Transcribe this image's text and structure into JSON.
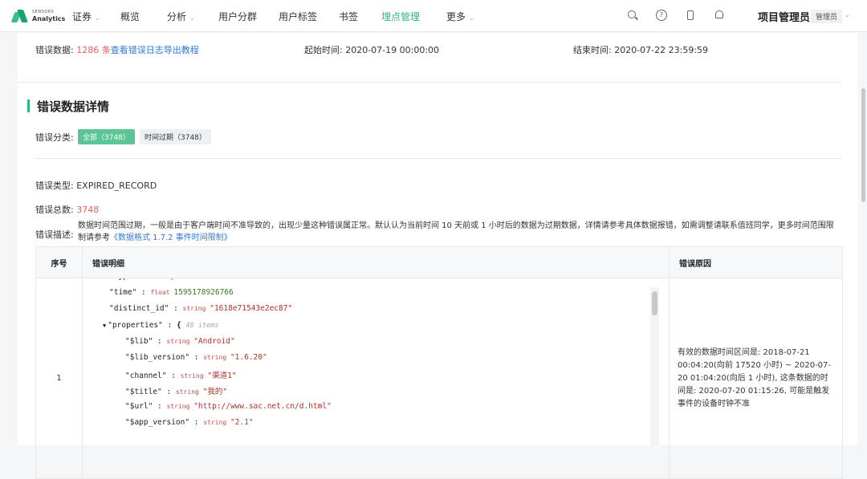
{
  "topbar": {
    "logo_line1": "SENSORS",
    "logo_line2": "Analytics",
    "nav": [
      {
        "label": "证券",
        "caret": "⌄"
      },
      {
        "label": "概览"
      },
      {
        "label": "分析",
        "caret": "⌄"
      },
      {
        "label": "用户分群"
      },
      {
        "label": "用户标签"
      },
      {
        "label": "书签"
      },
      {
        "label": "埋点管理",
        "active": true
      },
      {
        "label": "更多",
        "caret": "⌄"
      }
    ],
    "icons": [
      "search-icon",
      "help-icon",
      "mobile-icon",
      "bell-icon"
    ],
    "help_glyph": "?",
    "project": "项目管理员",
    "role": "管理员",
    "accent": "#32b583"
  },
  "summary": {
    "error_data_label": "错误数据:",
    "error_count": "1286 条",
    "export_link": "查看错误日志导出教程",
    "start_label": "起始时间:",
    "start_value": "2020-07-19 00:00:00",
    "end_label": "结束时间:",
    "end_value": "2020-07-22 23:59:59"
  },
  "detail": {
    "title": "错误数据详情",
    "category_label": "错误分类:",
    "tags": [
      "全部（3748）",
      "时间过期（3748）"
    ],
    "type_label": "错误类型:",
    "type_value": "EXPIRED_RECORD",
    "total_label": "错误总数:",
    "total_value": "3748",
    "desc_label": "错误描述:",
    "desc_text": "数据时间范围过期，一般是由于客户端时间不准导致的，出现少量这种错误属正常。默认认为当前时间 10 天前或 1 小时后的数据为过期数据，详情请参考具体数据报错，如需调整请联系值班同学，更多时间范围限制请参考",
    "desc_link": "《数据格式 1.7.2 事件时间限制》"
  },
  "table": {
    "headers": [
      "序号",
      "错误明细",
      "错误原因"
    ],
    "row": {
      "index": "1",
      "code_lines": [
        {
          "key": "\"type\"",
          "type": "string",
          "value": "\"track\"",
          "vclass": "st",
          "indent": 0
        },
        {
          "key": "\"time\"",
          "type": "float",
          "value": "1595178926766",
          "vclass": "nm",
          "indent": 0
        },
        {
          "key": "\"distinct_id\"",
          "type": "string",
          "value": "\"1618e71543e2ec87\"",
          "vclass": "st",
          "indent": 0
        },
        {
          "key": "\"properties\"",
          "type": "{",
          "value": "48 items",
          "vclass": "cm",
          "indent": 0,
          "toggle": "▼"
        },
        {
          "key": "\"$lib\"",
          "type": "string",
          "value": "\"Android\"",
          "vclass": "st",
          "indent": 1
        },
        {
          "key": "\"$lib_version\"",
          "type": "string",
          "value": "\"1.6.20\"",
          "vclass": "st",
          "indent": 1
        },
        {
          "key": "\"channel\"",
          "type": "string",
          "value": "\"渠道1\"",
          "vclass": "st",
          "indent": 1
        },
        {
          "key": "\"$title\"",
          "type": "string",
          "value": "\"我的\"",
          "vclass": "st",
          "indent": 1
        },
        {
          "key": "\"$url\"",
          "type": "string",
          "value": "\"http://www.sac.net.cn/d.html\"",
          "vclass": "st",
          "indent": 1
        },
        {
          "key": "\"$app_version\"",
          "type": "string",
          "value": "\"2.1\"",
          "vclass": "st",
          "indent": 1
        }
      ],
      "reason": "有效的数据时间区间是: 2018-07-21 00:04:20(向前 17520 小时) ~ 2020-07-20 01:04:20(向后 1 小时), 这条数据的时间是: 2020-07-20 01:15:26, 可能是触发事件的设备时钟不准"
    }
  }
}
